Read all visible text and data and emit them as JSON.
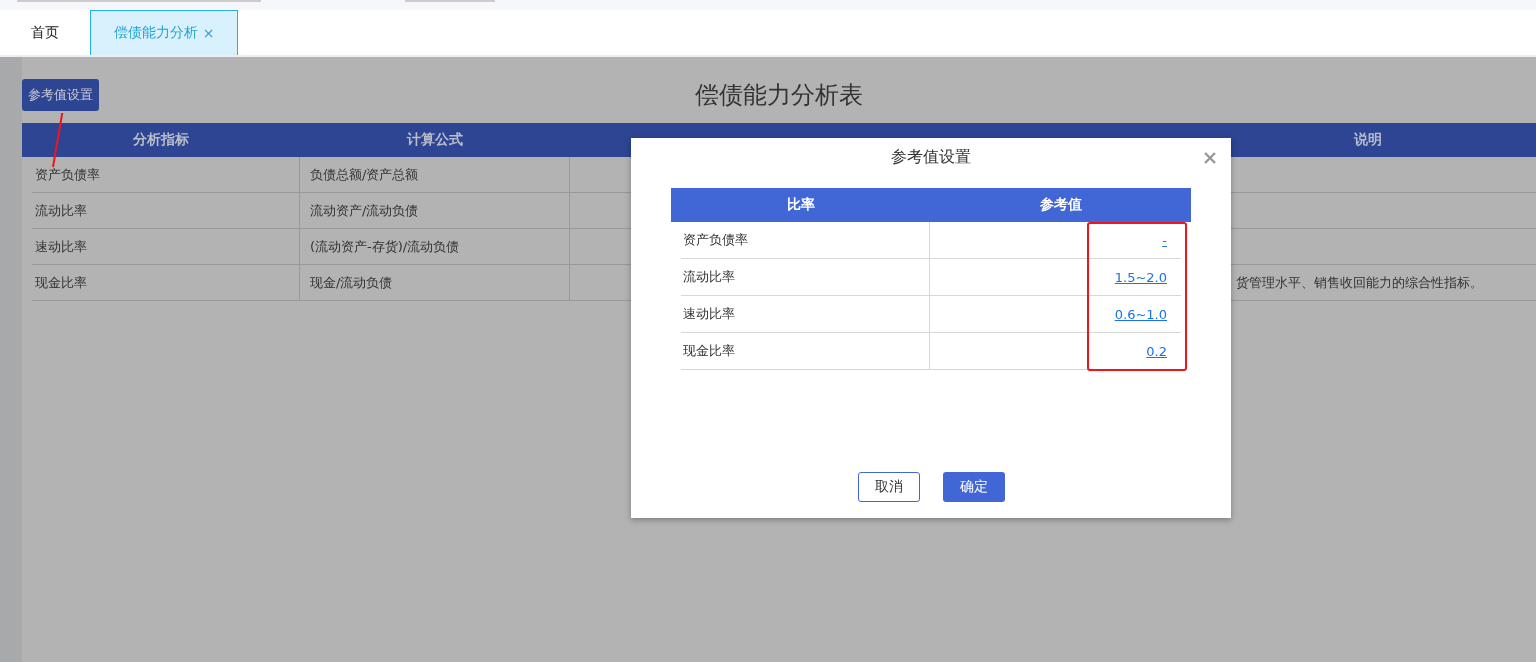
{
  "tabs": [
    {
      "label": "首页",
      "selected": false
    },
    {
      "label": "偿债能力分析",
      "selected": true,
      "close": "×"
    }
  ],
  "page": {
    "settings_button": "参考值设置",
    "title": "偿债能力分析表",
    "table": {
      "columns": [
        "分析指标",
        "计算公式",
        "说明"
      ],
      "rows": [
        {
          "indicator": "资产负债率",
          "formula": "负债总额/资产总额"
        },
        {
          "indicator": "流动比率",
          "formula": "流动资产/流动负债"
        },
        {
          "indicator": "速动比率",
          "formula": "(流动资产-存货)/流动负债"
        },
        {
          "indicator": "现金比率",
          "formula": "现金/流动负债",
          "description": "货管理水平、销售收回能力的综合性指标。"
        }
      ]
    }
  },
  "dialog": {
    "title": "参考值设置",
    "columns": [
      "比率",
      "参考值"
    ],
    "rows": [
      {
        "ratio": "资产负债率",
        "value": "-"
      },
      {
        "ratio": "流动比率",
        "value": "1.5~2.0"
      },
      {
        "ratio": "速动比率",
        "value": "0.6~1.0"
      },
      {
        "ratio": "现金比率",
        "value": "0.2"
      }
    ],
    "buttons": [
      {
        "label": "取消",
        "kind": "secondary"
      },
      {
        "label": "确定",
        "kind": "primary"
      }
    ]
  }
}
